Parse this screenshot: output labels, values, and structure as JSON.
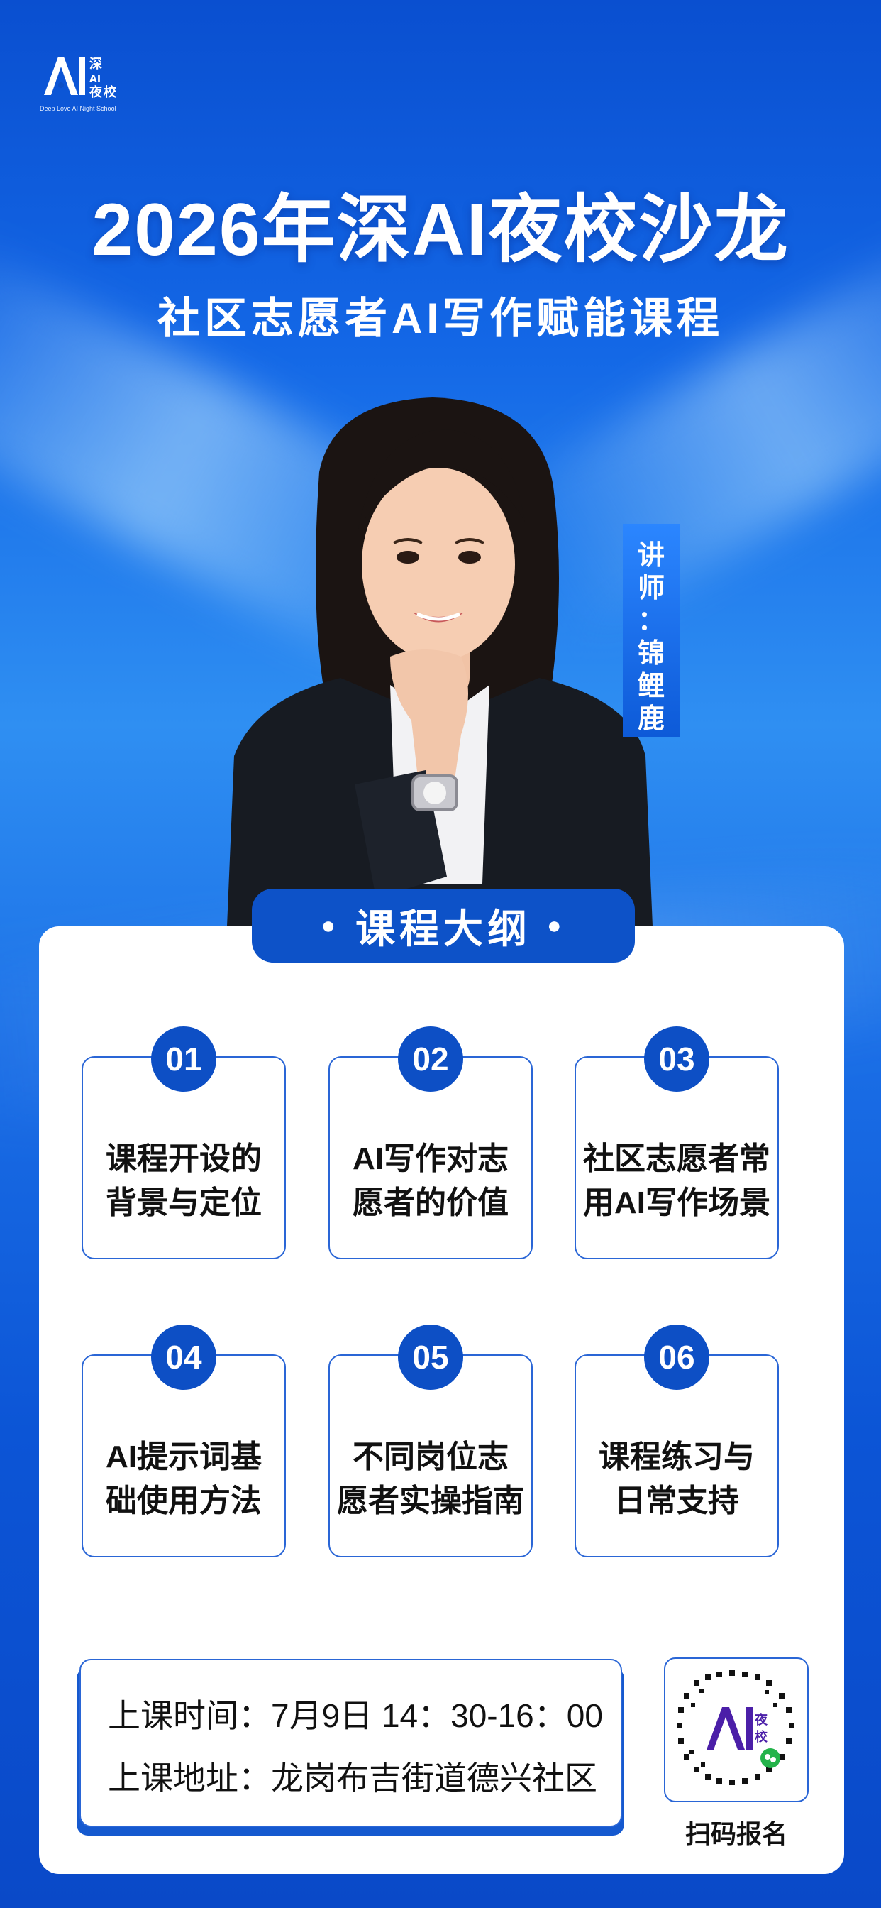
{
  "logo": {
    "brand": "深AI夜校",
    "tagline": "Deep Love AI Night School"
  },
  "header": {
    "title": "2026年深AI夜校沙龙",
    "subtitle": "社区志愿者AI写作赋能课程"
  },
  "teacher": {
    "label_chars": [
      "讲",
      "师",
      "：",
      "锦",
      "鲤",
      "鹿"
    ]
  },
  "outline": {
    "heading": "课程大纲",
    "items": [
      {
        "num": "01",
        "text": "课程开设的\n背景与定位"
      },
      {
        "num": "02",
        "text": "AI写作对志\n愿者的价值"
      },
      {
        "num": "03",
        "text": "社区志愿者常\n用AI写作场景"
      },
      {
        "num": "04",
        "text": "AI提示词基\n础使用方法"
      },
      {
        "num": "05",
        "text": "不同岗位志\n愿者实操指南"
      },
      {
        "num": "06",
        "text": "课程练习与\n日常支持"
      }
    ]
  },
  "info": {
    "time": "上课时间：7月9日  14：30-16：00",
    "address": "上课地址：龙岗布吉街道德兴社区"
  },
  "qr": {
    "label": "扫码报名"
  },
  "colors": {
    "primary": "#0d4fc5",
    "border": "#2a66d6",
    "background": "#1367e6"
  }
}
